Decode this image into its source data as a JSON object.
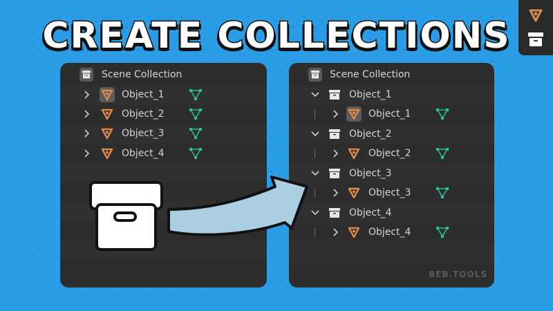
{
  "title": "CREATE COLLECTIONS",
  "watermark": "BEB.TOOLS",
  "colors": {
    "background": "#2b9de6",
    "panel": "#2d2d2d",
    "object_icon": "#e08a4a",
    "mesh_icon": "#27c29a",
    "arrow_fill": "#a9cfe0"
  },
  "left_panel": {
    "root": {
      "label": "Scene Collection",
      "icon": "collection-box-icon"
    },
    "items": [
      {
        "label": "Object_1",
        "icon": "object-icon",
        "data_icon": "mesh-data-icon",
        "selected": true
      },
      {
        "label": "Object_2",
        "icon": "object-icon",
        "data_icon": "mesh-data-icon",
        "selected": false
      },
      {
        "label": "Object_3",
        "icon": "object-icon",
        "data_icon": "mesh-data-icon",
        "selected": false
      },
      {
        "label": "Object_4",
        "icon": "object-icon",
        "data_icon": "mesh-data-icon",
        "selected": false
      }
    ]
  },
  "right_panel": {
    "root": {
      "label": "Scene Collection",
      "icon": "collection-box-icon"
    },
    "collections": [
      {
        "label": "Object_1",
        "icon": "collection-box-icon",
        "child": {
          "label": "Object_1",
          "icon": "object-icon",
          "data_icon": "mesh-data-icon",
          "selected": true
        }
      },
      {
        "label": "Object_2",
        "icon": "collection-box-icon",
        "child": {
          "label": "Object_2",
          "icon": "object-icon",
          "data_icon": "mesh-data-icon",
          "selected": false
        }
      },
      {
        "label": "Object_3",
        "icon": "collection-box-icon",
        "child": {
          "label": "Object_3",
          "icon": "object-icon",
          "data_icon": "mesh-data-icon",
          "selected": false
        }
      },
      {
        "label": "Object_4",
        "icon": "collection-box-icon",
        "child": {
          "label": "Object_4",
          "icon": "object-icon",
          "data_icon": "mesh-data-icon",
          "selected": false
        }
      }
    ]
  }
}
